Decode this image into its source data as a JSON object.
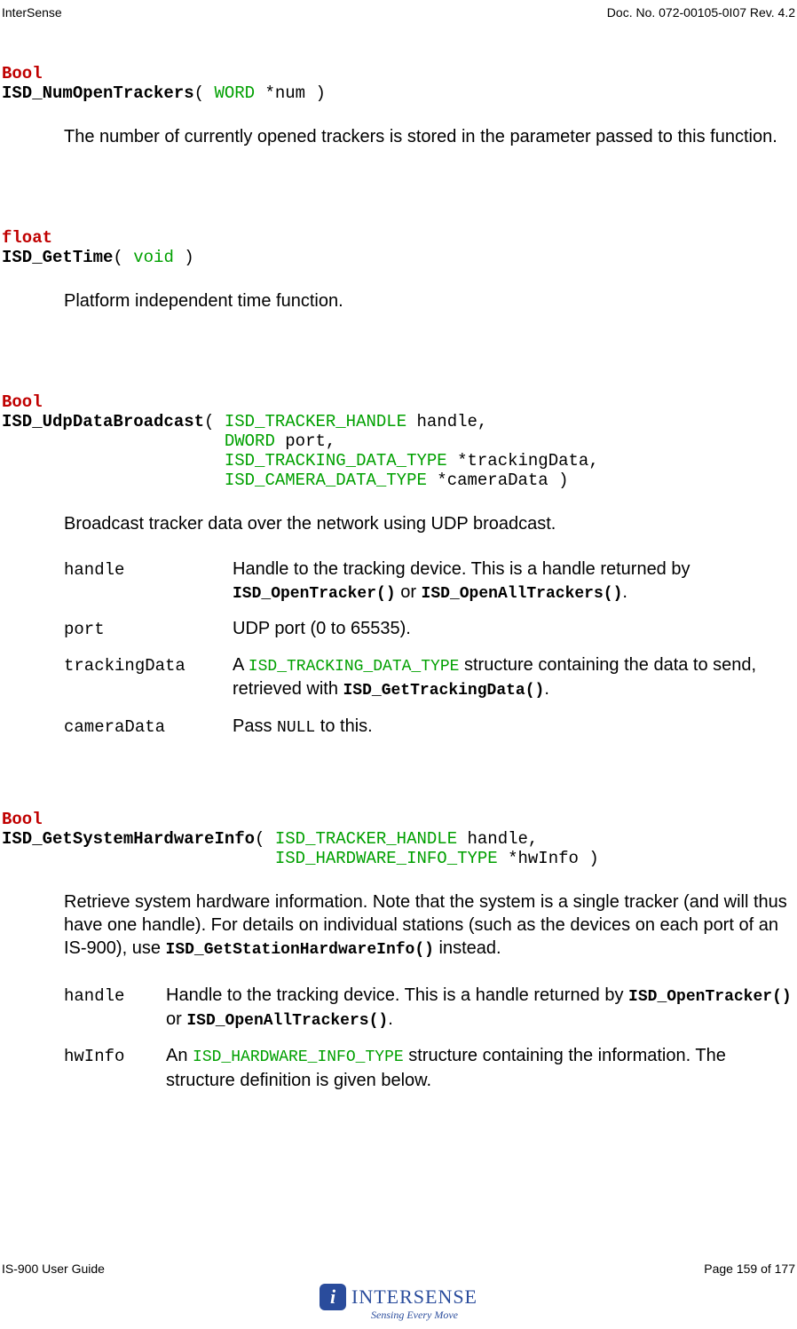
{
  "header": {
    "left": "InterSense",
    "right": "Doc. No. 072-00105-0I07 Rev. 4.2"
  },
  "func1": {
    "ret": "Bool",
    "name": "ISD_NumOpenTrackers",
    "sig_open": "( ",
    "ptype": "WORD",
    "pargs": " *num )",
    "desc": "The number of currently opened trackers is stored in the parameter passed to this function."
  },
  "func2": {
    "ret": "float",
    "name": "ISD_GetTime",
    "sig_open": "( ",
    "ptype": "void",
    "pargs": " )",
    "desc": "Platform independent time function."
  },
  "func3": {
    "ret": "Bool",
    "name": "ISD_UdpDataBroadcast",
    "open": "( ",
    "t1": "ISD_TRACKER_HANDLE",
    "a1": " handle,",
    "pad": "                      ",
    "t2": "DWORD",
    "a2": " port,",
    "t3": "ISD_TRACKING_DATA_TYPE",
    "a3": " *trackingData,",
    "t4": "ISD_CAMERA_DATA_TYPE",
    "a4": " *cameraData )",
    "desc": "Broadcast tracker data over the network using UDP broadcast.",
    "params": {
      "p1n": "handle",
      "p1d_a": "Handle to the tracking device.  This is a handle returned by ",
      "p1d_b": "ISD_OpenTracker()",
      "p1d_c": " or ",
      "p1d_d": "ISD_OpenAllTrackers()",
      "p1d_e": ".",
      "p2n": "port",
      "p2d": "UDP port (0 to 65535).",
      "p3n": "trackingData",
      "p3d_a": "A ",
      "p3d_b": "ISD_TRACKING_DATA_TYPE",
      "p3d_c": " structure containing the data to send, retrieved with ",
      "p3d_d": "ISD_GetTrackingData()",
      "p3d_e": ".",
      "p4n": "cameraData",
      "p4d_a": "Pass ",
      "p4d_b": "NULL",
      "p4d_c": " to this."
    }
  },
  "func4": {
    "ret": "Bool",
    "name": "ISD_GetSystemHardwareInfo",
    "open": "( ",
    "t1": "ISD_TRACKER_HANDLE",
    "a1": " handle,",
    "pad": "                           ",
    "t2": "ISD_HARDWARE_INFO_TYPE",
    "a2": " *hwInfo )",
    "desc_a": "Retrieve system hardware information.  Note that the system is a single tracker (and will thus have one handle).  For details on individual stations (such as the devices on each port of an IS-900), use ",
    "desc_b": "ISD_GetStationHardwareInfo()",
    "desc_c": " instead.",
    "params": {
      "p1n": "handle",
      "p1d_a": "Handle to the tracking device.  This is a handle returned by ",
      "p1d_b": "ISD_OpenTracker()",
      "p1d_c": " or ",
      "p1d_d": "ISD_OpenAllTrackers()",
      "p1d_e": ".",
      "p2n": "hwInfo",
      "p2d_a": "An ",
      "p2d_b": "ISD_HARDWARE_INFO_TYPE",
      "p2d_c": " structure containing the information.  The structure definition is given below."
    }
  },
  "footer": {
    "left": "IS-900 User Guide",
    "right": "Page 159 of 177"
  },
  "logo": {
    "icon": "i",
    "text": "INTERSENSE",
    "tag": "Sensing Every Move"
  }
}
